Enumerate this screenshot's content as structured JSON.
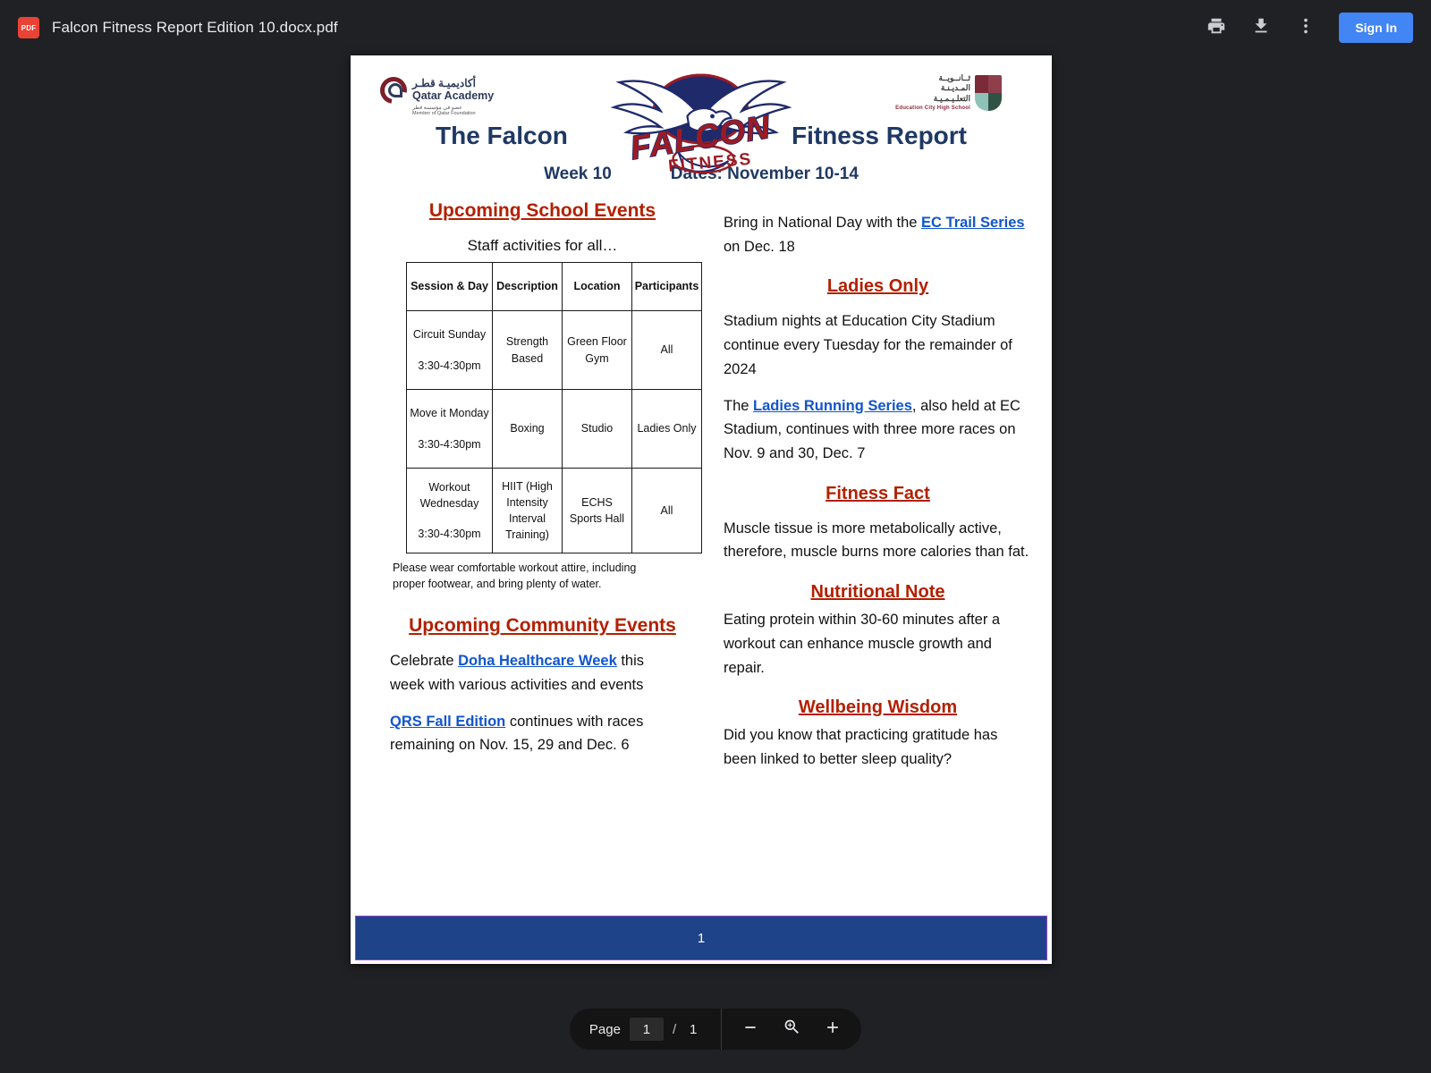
{
  "topbar": {
    "file_badge": "PDF",
    "file_title": "Falcon Fitness Report Edition 10.docx.pdf",
    "print_icon": "print-icon",
    "download_icon": "download-icon",
    "more_icon": "more-vertical-icon",
    "sign_in_label": "Sign In",
    "accent_color": "#4285f4"
  },
  "document": {
    "logos": {
      "qatar_academy": {
        "arabic": "أكاديميـة قطـر",
        "english": "Qatar Academy",
        "arabic_sub": "عضو في مؤسسة قطر",
        "sub": "Member of Qatar Foundation"
      },
      "falcon": {
        "word_main": "FALCON",
        "word_sub": "FITNESS"
      },
      "echs": {
        "arabic_line1": "ثــانــويــة",
        "arabic_line2": "المـديـنـة",
        "arabic_line3": "التعلـيـمـيـة",
        "english": "Education City High School"
      }
    },
    "title_left": "The Falcon",
    "title_right": "Fitness Report",
    "week": "Week 10",
    "dates": "Dates: November 10-14",
    "left_column": {
      "school_events_heading": "Upcoming School Events",
      "staff_line": "Staff activities for all…",
      "table": {
        "headers": [
          "Session & Day",
          "Description",
          "Location",
          "Participants"
        ],
        "rows": [
          {
            "session": "Circuit Sunday",
            "time": "3:30-4:30pm",
            "description": "Strength Based",
            "location": "Green Floor Gym",
            "participants": "All"
          },
          {
            "session": "Move it Monday",
            "time": "3:30-4:30pm",
            "description": "Boxing",
            "location": "Studio",
            "participants": "Ladies Only"
          },
          {
            "session": "Workout Wednesday",
            "time": "3:30-4:30pm",
            "description": "HIIT (High Intensity Interval Training)",
            "location": "ECHS Sports Hall",
            "participants": "All"
          }
        ]
      },
      "table_note": "Please wear comfortable workout attire, including proper footwear, and bring plenty of water.",
      "community_events_heading": "Upcoming Community Events",
      "community_p1_pre": "Celebrate ",
      "community_p1_link": "Doha Healthcare Week",
      "community_p1_post": " this week with various activities and events",
      "community_p2_link": "QRS Fall Edition",
      "community_p2_post": " continues with races remaining on Nov. 15,  29 and Dec. 6"
    },
    "right_column": {
      "national_day_pre": "Bring in National Day with the ",
      "national_day_link": "EC Trail Series",
      "national_day_post": " on Dec. 18",
      "ladies_only_heading": "Ladies Only",
      "ladies_p1": "Stadium nights at Education City Stadium continue every Tuesday for the remainder of 2024",
      "ladies_p2_pre": " The ",
      "ladies_p2_link": "Ladies Running Series",
      "ladies_p2_post": ", also held at EC Stadium, continues with three more races on Nov. 9 and 30, Dec. 7",
      "fitness_fact_heading": "Fitness Fact",
      "fitness_fact_body": "Muscle tissue is more metabolically active, therefore, muscle burns more calories than fat.",
      "nutritional_note_heading": "Nutritional Note",
      "nutritional_note_body": "Eating protein within 30-60 minutes after a workout can enhance muscle growth and repair.",
      "wellbeing_heading": " Wellbeing Wisdom",
      "wellbeing_body": "Did you know that practicing gratitude has been linked to better sleep quality?"
    },
    "footer_page_number": "1",
    "colors": {
      "title_blue": "#1f3864",
      "section_red": "#b22000",
      "link_blue": "#1155cc",
      "footer_band": "#1f4389",
      "footer_border": "#8b44c8"
    }
  },
  "bottombar": {
    "page_label": "Page",
    "current_page": "1",
    "separator": "/",
    "total_pages": "1",
    "zoom_out_icon": "minus-icon",
    "zoom_icon": "magnifier-plus-icon",
    "zoom_in_icon": "plus-icon"
  }
}
